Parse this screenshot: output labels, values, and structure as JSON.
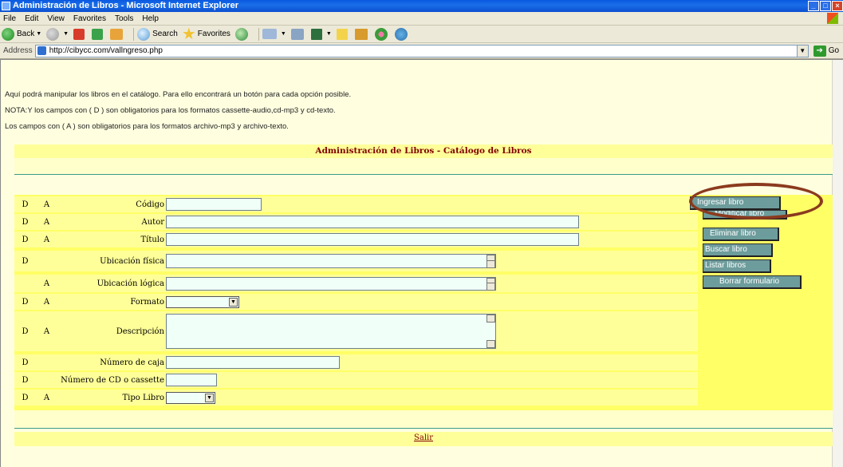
{
  "window": {
    "title": "Administración de Libros - Microsoft Internet Explorer",
    "controls": [
      "_",
      "□",
      "×"
    ]
  },
  "menu": [
    "File",
    "Edit",
    "View",
    "Favorites",
    "Tools",
    "Help"
  ],
  "toolbar": {
    "back": "Back",
    "search": "Search",
    "favorites": "Favorites"
  },
  "address": {
    "label": "Address",
    "url": "http://cibycc.com/vallngreso.php",
    "go": "Go"
  },
  "intro": {
    "line1": "Aquí podrá manipular los libros en el catálogo. Para ello encontrará un botón para cada opción posible.",
    "line2": "NOTA:Y los campos con ( D ) son obligatorios para los formatos cassette-audio,cd-mp3 y cd-texto.",
    "line3": "Los campos con ( A ) son obligatorios para los formatos archivo-mp3 y archivo-texto."
  },
  "heading": "Administración de Libros - Catálogo de Libros",
  "form": {
    "fields": [
      {
        "d": "D",
        "a": "A",
        "label": "Código",
        "type": "text"
      },
      {
        "d": "D",
        "a": "A",
        "label": "Autor",
        "type": "text"
      },
      {
        "d": "D",
        "a": "A",
        "label": "Título",
        "type": "text"
      },
      {
        "d": "D",
        "a": "",
        "label": "Ubicación física",
        "type": "textarea-small"
      },
      {
        "d": "",
        "a": "A",
        "label": "Ubicación lógica",
        "type": "textarea-small"
      },
      {
        "d": "D",
        "a": "A",
        "label": "Formato",
        "type": "select"
      },
      {
        "d": "D",
        "a": "A",
        "label": "Descripción",
        "type": "textarea"
      },
      {
        "d": "D",
        "a": "",
        "label": "Número de caja",
        "type": "text"
      },
      {
        "d": "D",
        "a": "",
        "label": "Número de CD o cassette",
        "type": "text"
      },
      {
        "d": "D",
        "a": "A",
        "label": "Tipo Libro",
        "type": "select"
      }
    ]
  },
  "buttons": {
    "ingresar": "Ingresar libro",
    "modificar": "Modificar libro",
    "eliminar": "Eliminar libro",
    "buscar": "Buscar libro",
    "listar": "Listar libros",
    "borrar": "Borrar formulario"
  },
  "footer": {
    "salir": "Salir"
  }
}
